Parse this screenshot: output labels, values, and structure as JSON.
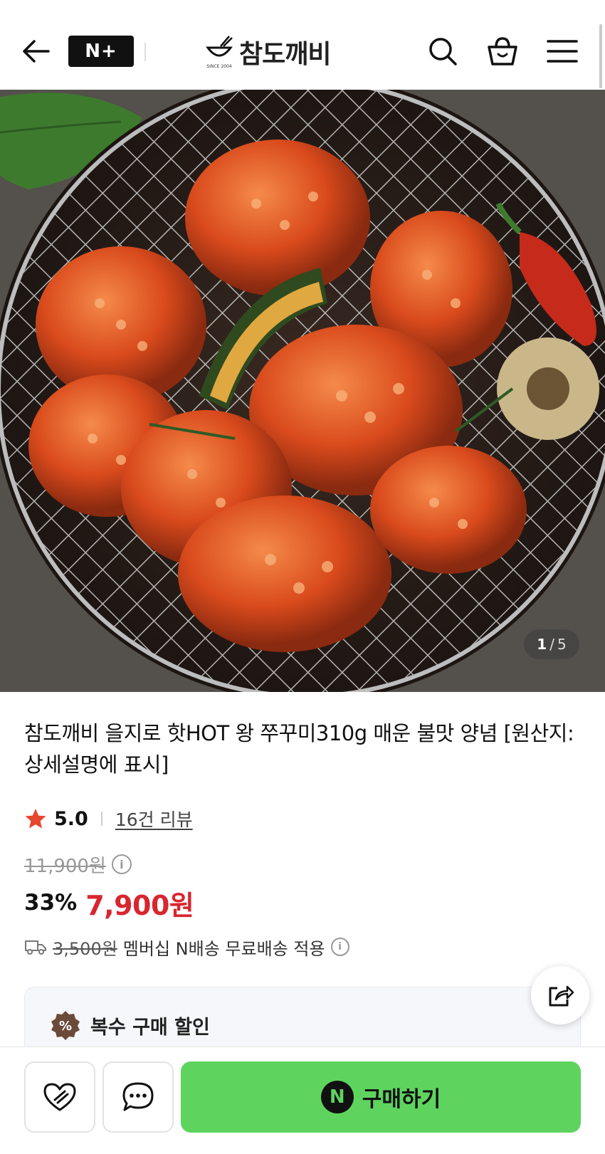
{
  "header": {
    "back_icon": "arrow-left-icon",
    "nplus_label": "N+",
    "brand_name": "참도깨비",
    "brand_since": "SINCE 2004",
    "search_icon": "search-icon",
    "cart_icon": "shopping-basket-icon",
    "menu_icon": "hamburger-menu-icon"
  },
  "gallery": {
    "current": "1",
    "separator": "/",
    "total": "5"
  },
  "product": {
    "title": "참도깨비 을지로 핫HOT 왕 쭈꾸미310g 매운 불맛 양념 [원산지:상세설명에 표시]",
    "rating": "5.0",
    "review_link": "16건 리뷰",
    "original_price": "11,900원",
    "discount_rate": "33%",
    "sale_price": "7,900원",
    "delivery_fee": "3,500원",
    "delivery_note": "멤버십 N배송 무료배송 적용"
  },
  "multi_buy": {
    "badge_symbol": "%",
    "label": "복수 구매 할인"
  },
  "bottom_bar": {
    "buy_badge": "N",
    "buy_label": "구매하기"
  },
  "colors": {
    "sale_price": "#d8262e",
    "buy_button": "#5ed45f",
    "star": "#e8452c"
  }
}
